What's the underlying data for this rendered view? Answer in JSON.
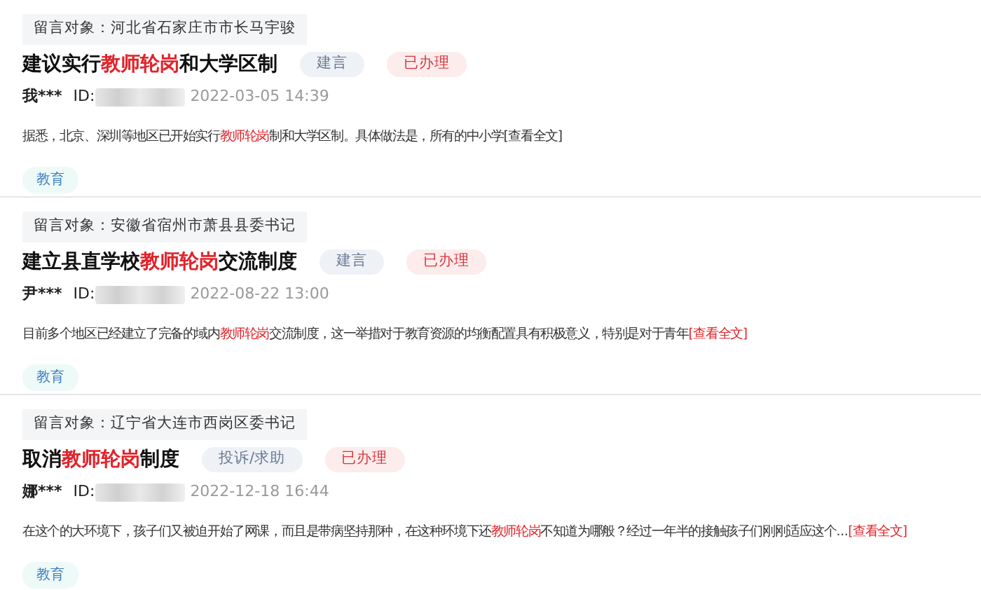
{
  "messages": [
    {
      "target": "留言对象：河北省石家庄市市长马宇骏",
      "title": [
        {
          "text": "建议实行",
          "highlight": false
        },
        {
          "text": "教师轮岗",
          "highlight": true
        },
        {
          "text": "和大学区制",
          "highlight": false
        }
      ],
      "category": "建言",
      "status": "已办理",
      "author": "我***",
      "id_label": "ID:",
      "time": "2022-03-05 14:39",
      "body": [
        {
          "text": "据悉，北京、深圳等地区已开始实行",
          "highlight": false
        },
        {
          "text": "教师轮岗",
          "highlight": true
        },
        {
          "text": "制和大学区制。具体做法是，所有的中小学",
          "highlight": false
        }
      ],
      "read_more": {
        "text": "[查看全文]",
        "highlight": false
      },
      "tag": "教育"
    },
    {
      "target": "留言对象：安徽省宿州市萧县县委书记",
      "title": [
        {
          "text": "建立县直学校",
          "highlight": false
        },
        {
          "text": "教师轮岗",
          "highlight": true
        },
        {
          "text": "交流制度",
          "highlight": false
        }
      ],
      "category": "建言",
      "status": "已办理",
      "author": "尹***",
      "id_label": "ID:",
      "time": "2022-08-22 13:00",
      "body": [
        {
          "text": "目前多个地区已经建立了完备的域内",
          "highlight": false
        },
        {
          "text": "教师轮岗",
          "highlight": true
        },
        {
          "text": "交流制度，这一举措对于教育资源的均衡配置具有积极意义，特别是对于青年",
          "highlight": false
        }
      ],
      "read_more": {
        "text": "[查看全文]",
        "highlight": true
      },
      "tag": "教育"
    },
    {
      "target": "留言对象：辽宁省大连市西岗区委书记",
      "title": [
        {
          "text": "取消",
          "highlight": false
        },
        {
          "text": "教师轮岗",
          "highlight": true
        },
        {
          "text": "制度",
          "highlight": false
        }
      ],
      "category": "投诉/求助",
      "status": "已办理",
      "author": "娜***",
      "id_label": "ID:",
      "time": "2022-12-18 16:44",
      "body": [
        {
          "text": "在这个的大环境下，孩子们又被迫开始了网课，而且是带病坚持那种，在这种环境下还",
          "highlight": false
        },
        {
          "text": "教师轮岗",
          "highlight": true
        },
        {
          "text": "不知道为哪般？经过一年半的接触孩子们刚刚适应这个...",
          "highlight": false
        }
      ],
      "read_more": {
        "text": "[查看全文]",
        "highlight": true
      },
      "tag": "教育"
    }
  ]
}
